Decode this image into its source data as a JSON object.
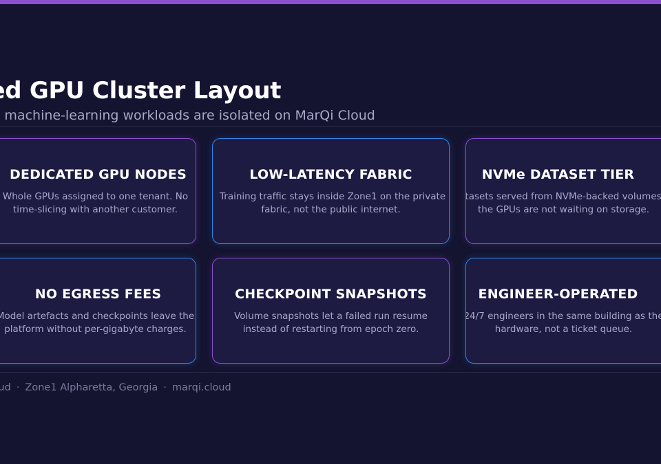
{
  "header": {
    "title": "Dedicated GPU Cluster Layout",
    "subtitle": "AI and machine-learning workloads are isolated on MarQi Cloud"
  },
  "cards": [
    {
      "title": "DEDICATED GPU NODES",
      "lines": [
        "Whole GPUs assigned to one tenant. No",
        "time-slicing with another customer."
      ],
      "accent": "#8a4fcf"
    },
    {
      "title": "LOW-LATENCY FABRIC",
      "lines": [
        "Training traffic stays inside Zone1 on the private",
        "fabric, not the public internet."
      ],
      "accent": "#2f86e8"
    },
    {
      "title": "NVMe DATASET TIER",
      "lines": [
        "Datasets served from NVMe-backed volumes so",
        "the GPUs are not waiting on storage."
      ],
      "accent": "#8a4fcf"
    },
    {
      "title": "NO EGRESS FEES",
      "lines": [
        "Model artefacts and checkpoints leave the",
        "platform without per-gigabyte charges."
      ],
      "accent": "#2f86e8"
    },
    {
      "title": "CHECKPOINT SNAPSHOTS",
      "lines": [
        "Volume snapshots let a failed run resume",
        "instead of restarting from epoch zero."
      ],
      "accent": "#8a4fcf"
    },
    {
      "title": "ENGINEER-OPERATED",
      "lines": [
        "24/7 engineers in the same building as the",
        "hardware, not a ticket queue."
      ],
      "accent": "#2f86e8"
    }
  ],
  "footer": {
    "brand": "MarQi Cloud",
    "location": "Zone1 Alpharetta, Georgia",
    "website": "marqi.cloud",
    "separator": "·"
  },
  "colors": {
    "background": "#141430",
    "top_bar": "#8f4fd1",
    "purple_border": "#8a4fcf",
    "blue_border": "#2f86e8"
  }
}
